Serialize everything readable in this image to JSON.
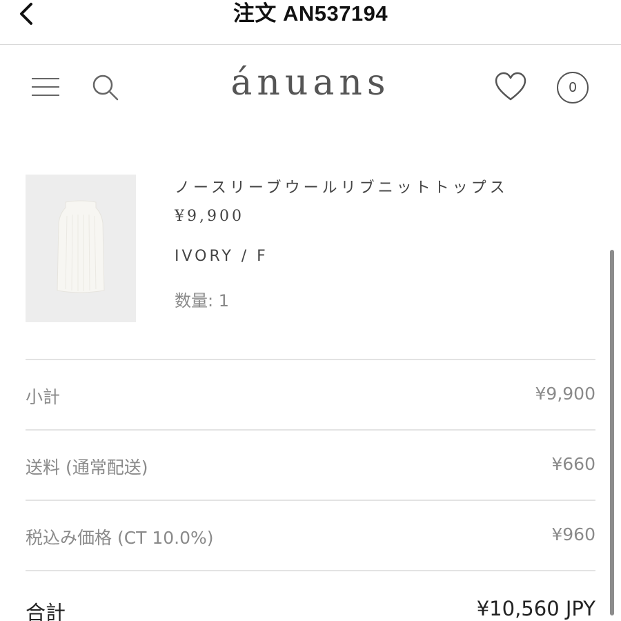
{
  "nav": {
    "title": "注文 AN537194"
  },
  "store": {
    "brand": "ánuans",
    "cart_count": "0"
  },
  "product": {
    "name": "ノースリーブウールリブニットトップス",
    "price": "¥9,900",
    "variant": "IVORY / F",
    "quantity": "数量: 1"
  },
  "summary": {
    "subtotal_label": "小計",
    "subtotal_value": "¥9,900",
    "shipping_label": "送料 (通常配送)",
    "shipping_value": "¥660",
    "tax_label": "税込み価格 (CT 10.0%)",
    "tax_value": "¥960",
    "total_label": "合計",
    "total_value": "¥10,560 JPY"
  },
  "icons": {
    "back": "chevron-left-icon",
    "menu": "hamburger-menu-icon",
    "search": "search-icon",
    "favorite": "heart-icon",
    "cart": "cart-count-badge"
  }
}
